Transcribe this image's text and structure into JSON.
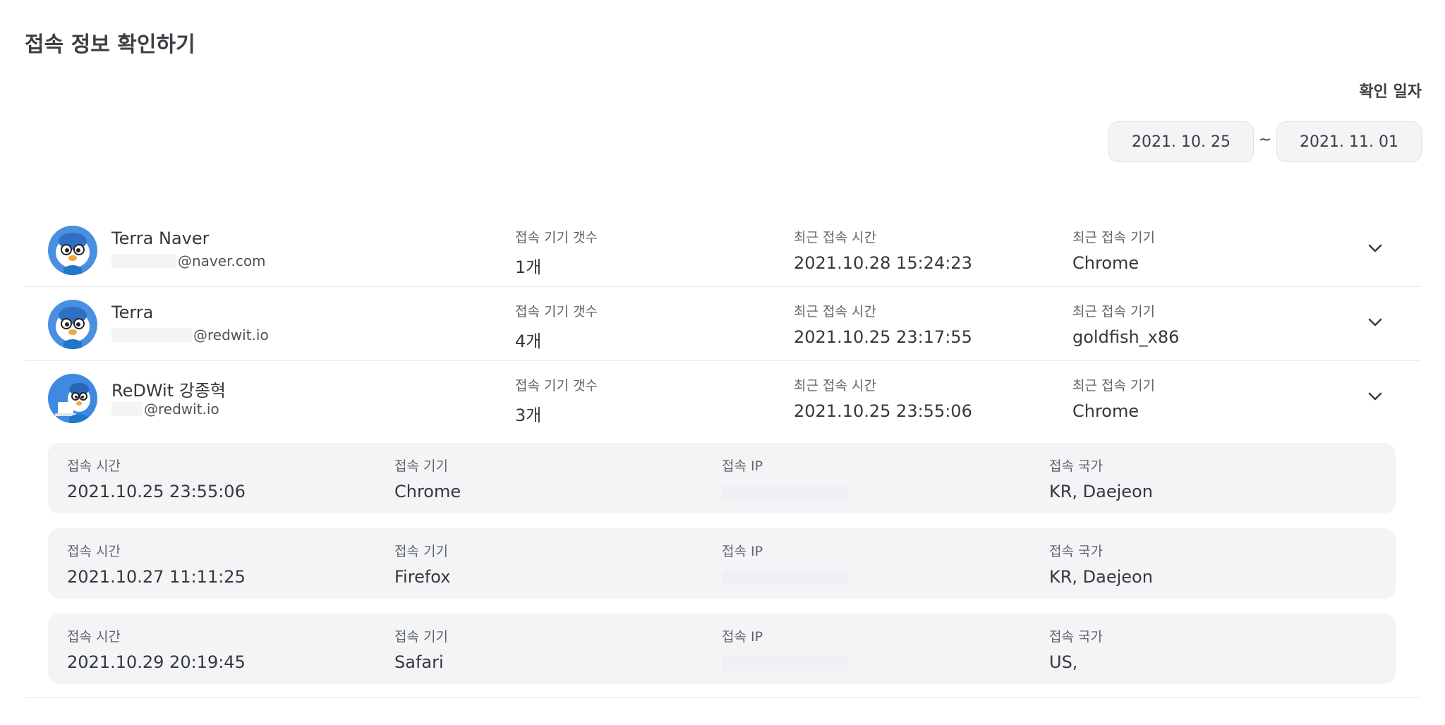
{
  "page": {
    "title": "접속 정보 확인하기"
  },
  "date_filter": {
    "label": "확인 일자",
    "start": "2021. 10. 25",
    "separator": "~",
    "end": "2021. 11. 01"
  },
  "users": [
    {
      "name": "Terra Naver",
      "email_suffix": "@naver.com",
      "device_count_label": "접속 기기 갯수",
      "device_count": "1개",
      "recent_time_label": "최근 접속 시간",
      "recent_time": "2021.10.28 15:24:23",
      "recent_device_label": "최근 접속 기기",
      "recent_device": "Chrome",
      "avatar_icon": "penguin-avatar-icon"
    },
    {
      "name": "Terra",
      "email_suffix": "@redwit.io",
      "device_count_label": "접속 기기 갯수",
      "device_count": "4개",
      "recent_time_label": "최근 접속 시간",
      "recent_time": "2021.10.25 23:17:55",
      "recent_device_label": "최근 접속 기기",
      "recent_device": "goldfish_x86",
      "avatar_icon": "penguin-avatar-icon"
    },
    {
      "name": "ReDWit 강종혁",
      "email_suffix": "@redwit.io",
      "device_count_label": "접속 기기 갯수",
      "device_count": "3개",
      "recent_time_label": "최근 접속 시간",
      "recent_time": "2021.10.25 23:55:06",
      "recent_device_label": "최근 접속 기기",
      "recent_device": "Chrome",
      "avatar_icon": "penguin-laptop-avatar-icon"
    }
  ],
  "sessions": [
    {
      "time_label": "접속 시간",
      "time": "2021.10.25 23:55:06",
      "device_label": "접속 기기",
      "device": "Chrome",
      "ip_label": "접속 IP",
      "country_label": "접속 국가",
      "country": "KR, Daejeon"
    },
    {
      "time_label": "접속 시간",
      "time": "2021.10.27 11:11:25",
      "device_label": "접속 기기",
      "device": "Firefox",
      "ip_label": "접속 IP",
      "country_label": "접속 국가",
      "country": "KR, Daejeon"
    },
    {
      "time_label": "접속 시간",
      "time": "2021.10.29 20:19:45",
      "device_label": "접속 기기",
      "device": "Safari",
      "ip_label": "접속 IP",
      "country_label": "접속 국가",
      "country": "US,"
    }
  ],
  "colors": {
    "card_bg": "#f2f4f6",
    "avatar_blue": "#3f8ae0",
    "divider": "#e6e8eb"
  }
}
